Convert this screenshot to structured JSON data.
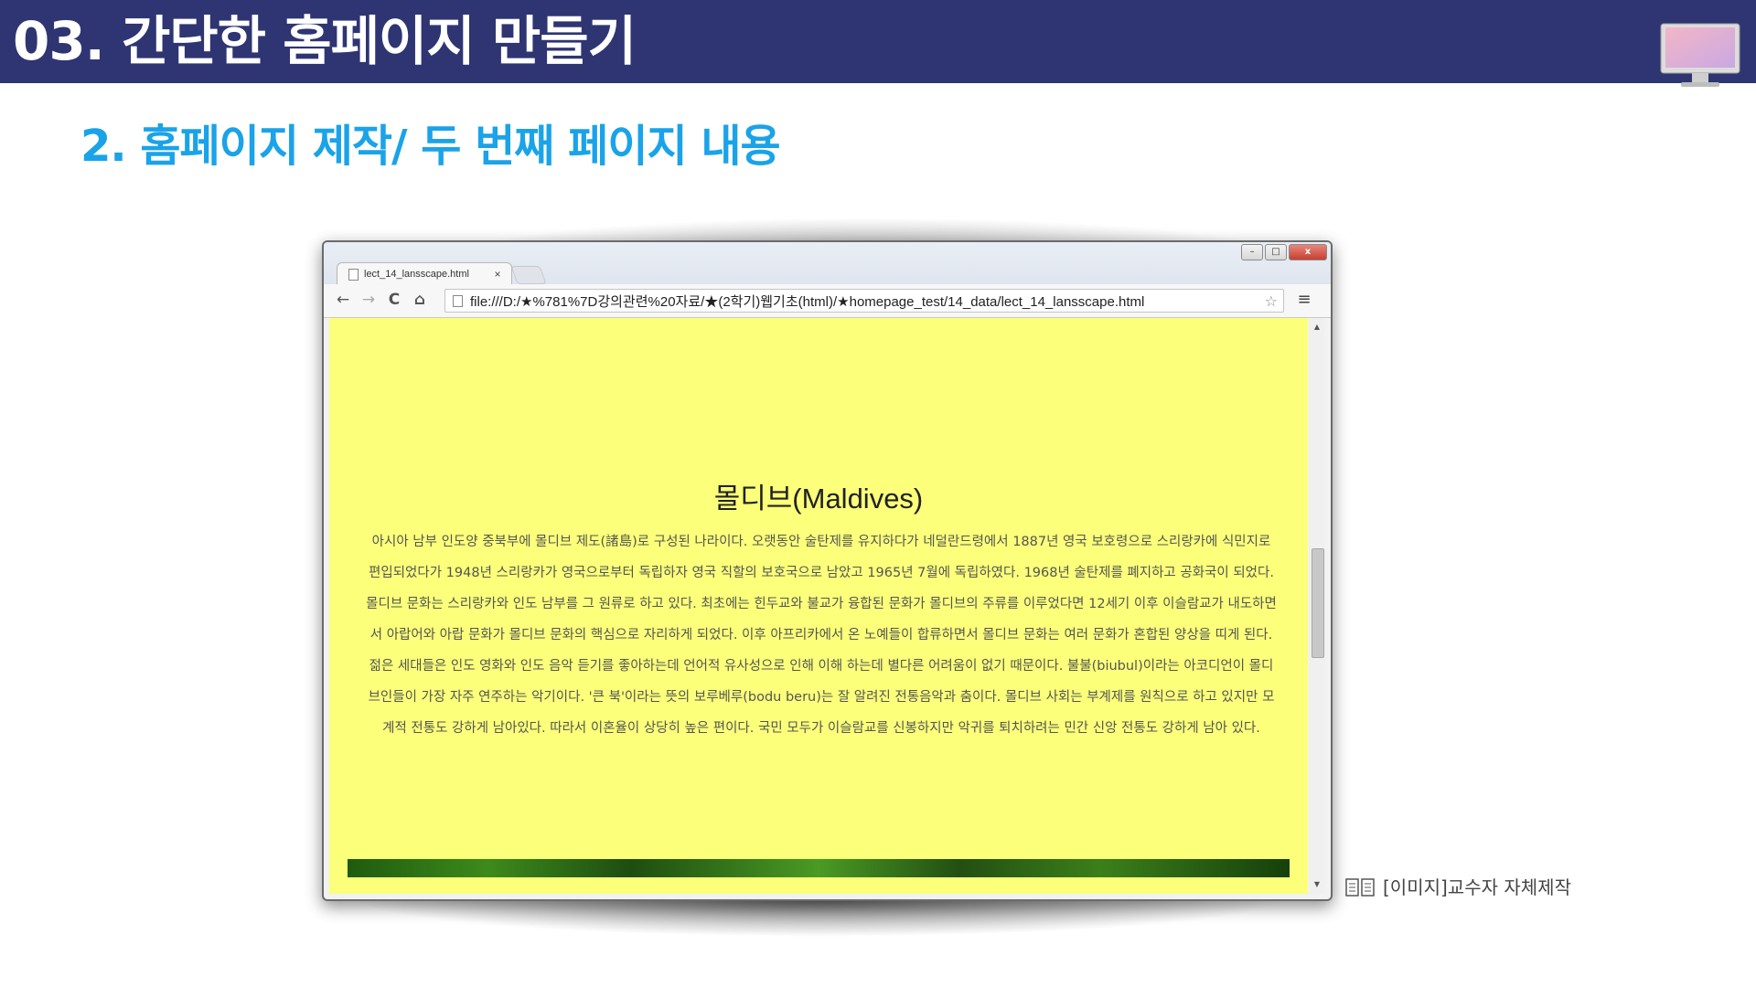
{
  "slide": {
    "title": "03. 간단한 홈페이지 만들기",
    "subtitle": "2. 홈페이지 제작/ 두 번째 페이지 내용",
    "credit": "[이미지]교수자 자체제작",
    "colors": {
      "header_bar": "#2e3572",
      "subtitle": "#1aa3e8",
      "page_background": "#fcff79"
    }
  },
  "browser": {
    "tab_label": "lect_14_lansscape.html",
    "tab_close": "×",
    "window_controls": {
      "close": "x"
    },
    "nav": {
      "back": "←",
      "forward": "→",
      "reload": "C",
      "home": "⌂",
      "menu": "≡"
    },
    "url": "file:///D:/★%781%7D강의관련%20자료/★(2학기)웹기초(html)/★homepage_test/14_data/lect_14_lansscape.html",
    "icons": [
      "doc-icon",
      "back-arrow-icon",
      "forward-arrow-icon",
      "reload-icon",
      "home-icon",
      "page-icon",
      "star-icon",
      "menu-icon",
      "monitor-icon",
      "book-icon"
    ]
  },
  "page": {
    "heading": "몰디브(Maldives)",
    "paragraphs": [
      "아시아 남부 인도양 중북부에 몰디브 제도(諸島)로 구성된 나라이다. 오랫동안 술탄제를 유지하다가 네덜란드령에서 1887년 영국 보호령으로 스리랑카에 식민지로 편입되었다가 1948년 스리랑카가 영국으로부터 독립하자 영국 직할의 보호국으로 남았고 1965년 7월에 독립하였다. 1968년 술탄제를 폐지하고 공화국이 되었다. 몰디브 문화는 스리랑카와 인도 남부를 그 원류로 하고 있다. 최초에는 힌두교와 불교가 융합된 문화가 몰디브의 주류를 이루었다면 12세기 이후 이슬람교가 내도하면서 아랍어와 아랍 문화가 몰디브 문화의 핵심으로 자리하게 되었다. 이후 아프리카에서 온 노예들이 합류하면서 몰디브 문화는 여러 문화가 혼합된 양상을 띠게 된다.",
      "젊은 세대들은 인도 영화와 인도 음악 듣기를 좋아하는데 언어적 유사성으로 인해 이해 하는데 별다른 어려움이 없기 때문이다. 불불(biubul)이라는 아코디언이 몰디브인들이 가장 자주 연주하는 악기이다. '큰 북'이라는 뜻의 보루베루(bodu beru)는 잘 알려진 전통음악과 춤이다. 몰디브 사회는 부계제를 원칙으로 하고 있지만 모계적 전통도 강하게 남아있다. 따라서 이혼율이 상당히 높은 편이다. 국민 모두가 이슬람교를 신봉하지만 악귀를 퇴치하려는 민간 신앙 전통도 강하게 남아 있다."
    ]
  }
}
